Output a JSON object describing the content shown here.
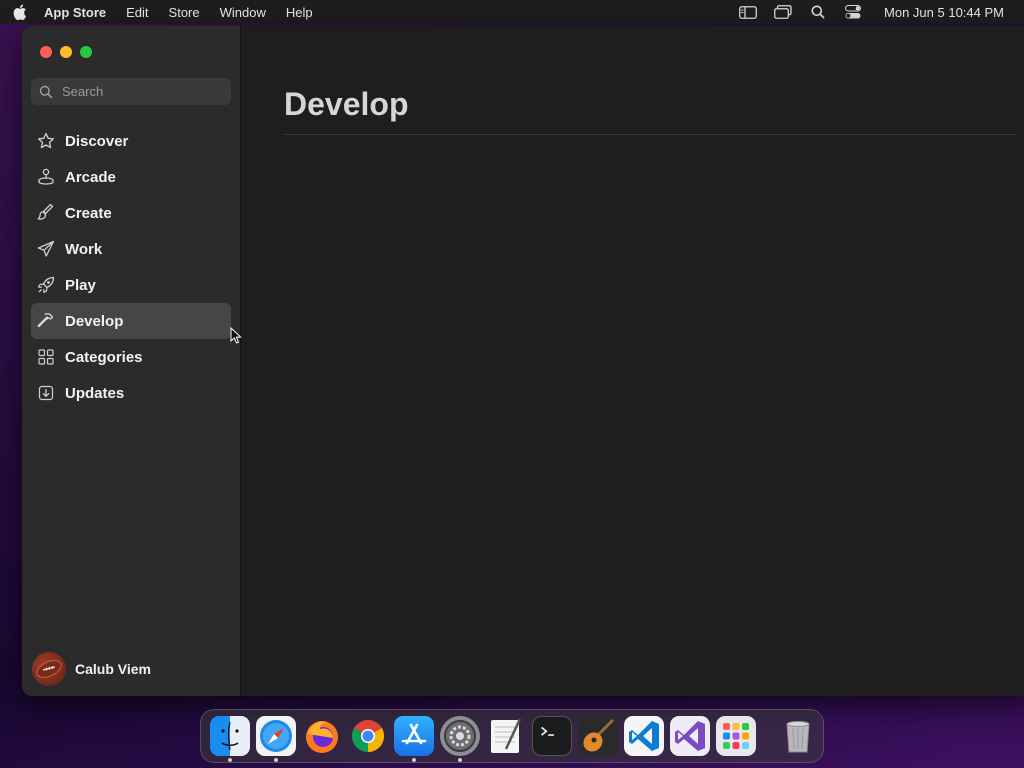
{
  "menubar": {
    "app_name": "App Store",
    "items": [
      "Edit",
      "Store",
      "Window",
      "Help"
    ],
    "clock": "Mon Jun 5  10:44 PM"
  },
  "search": {
    "placeholder": "Search"
  },
  "sidebar": {
    "items": [
      {
        "label": "Discover",
        "icon": "star-icon"
      },
      {
        "label": "Arcade",
        "icon": "joystick-icon"
      },
      {
        "label": "Create",
        "icon": "brush-icon"
      },
      {
        "label": "Work",
        "icon": "paper-plane-icon"
      },
      {
        "label": "Play",
        "icon": "rocket-icon"
      },
      {
        "label": "Develop",
        "icon": "hammer-icon",
        "active": true
      },
      {
        "label": "Categories",
        "icon": "grid-icon"
      },
      {
        "label": "Updates",
        "icon": "download-icon"
      }
    ]
  },
  "user": {
    "name": "Calub Viem"
  },
  "main": {
    "title": "Develop"
  },
  "dock": {
    "apps": [
      "finder",
      "safari",
      "firefox",
      "chrome",
      "app-store",
      "system-settings",
      "textedit",
      "terminal",
      "garageband",
      "vscode",
      "visual-studio",
      "launchpad"
    ],
    "trash": "trash"
  },
  "colors": {
    "sidebar_bg": "#2b2b2c",
    "main_bg": "#1e1e1e",
    "active_item_bg": "#464647",
    "traffic_red": "#ff5f57",
    "traffic_yellow": "#febc2e",
    "traffic_green": "#28c840"
  }
}
